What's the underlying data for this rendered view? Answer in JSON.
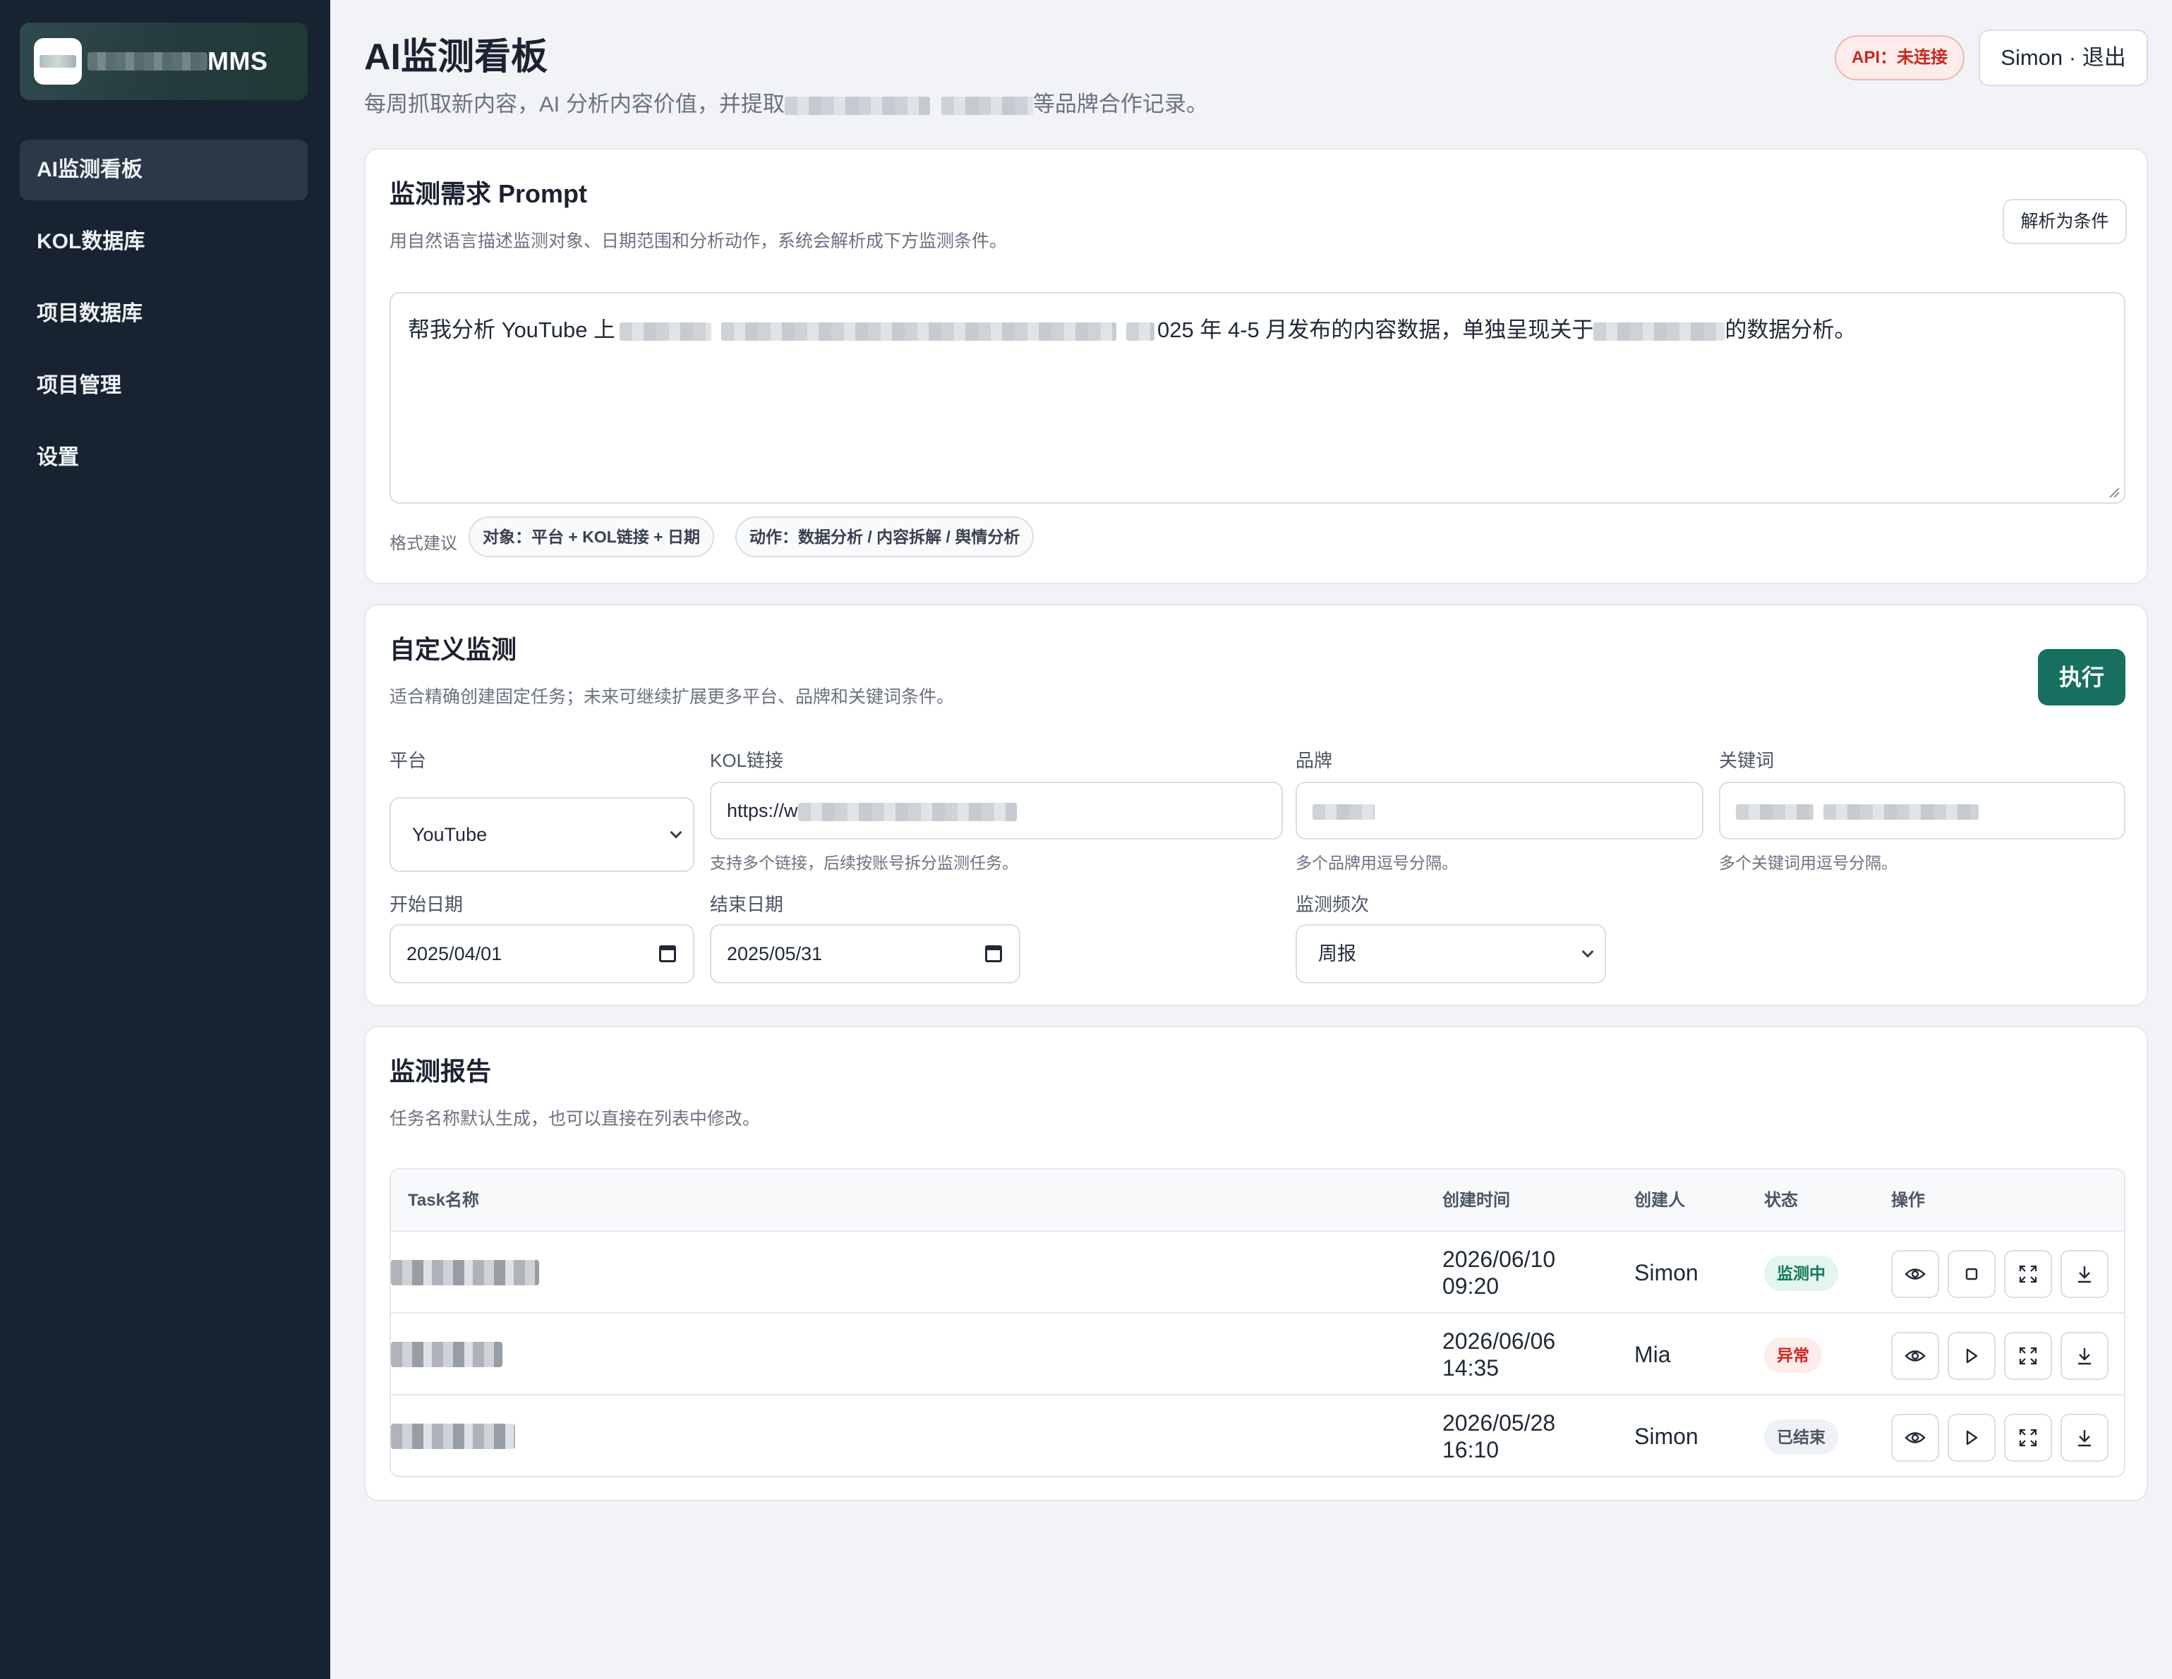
{
  "sidebar": {
    "brand": "MMS",
    "items": [
      {
        "label": "AI监测看板",
        "active": true
      },
      {
        "label": "KOL数据库"
      },
      {
        "label": "项目数据库"
      },
      {
        "label": "项目管理"
      },
      {
        "label": "设置"
      }
    ]
  },
  "header": {
    "title": "AI监测看板",
    "subtitle_prefix": "每周抓取新内容，AI 分析内容价值，并提取",
    "subtitle_suffix": "等品牌合作记录。",
    "api_badge": "API：未连接",
    "user_button": "Simon · 退出"
  },
  "prompt_card": {
    "title": "监测需求 Prompt",
    "description": "用自然语言描述监测对象、日期范围和分析动作，系统会解析成下方监测条件。",
    "parse_button": "解析为条件",
    "text_prefix": "帮我分析 YouTube 上",
    "text_middle": "025 年 4-5 月发布的内容数据，单独呈现关于",
    "text_suffix": "的数据分析。",
    "hint_label": "格式建议",
    "chips": [
      "对象：平台 + KOL链接 + 日期",
      "动作：数据分析 / 内容拆解 / 舆情分析"
    ]
  },
  "custom_card": {
    "title": "自定义监测",
    "description": "适合精确创建固定任务；未来可继续扩展更多平台、品牌和关键词条件。",
    "execute_button": "执行",
    "platform_label": "平台",
    "platform_value": "YouTube",
    "kol_label": "KOL链接",
    "kol_value": "https://w",
    "kol_help": "支持多个链接，后续按账号拆分监测任务。",
    "brand_label": "品牌",
    "brand_help": "多个品牌用逗号分隔。",
    "keyword_label": "关键词",
    "keyword_help": "多个关键词用逗号分隔。",
    "start_label": "开始日期",
    "start_value": "2025/04/01",
    "end_label": "结束日期",
    "end_value": "2025/05/31",
    "freq_label": "监测频次",
    "freq_value": "周报"
  },
  "reports_card": {
    "title": "监测报告",
    "description": "任务名称默认生成，也可以直接在列表中修改。",
    "columns": [
      "Task名称",
      "创建时间",
      "创建人",
      "状态",
      "操作"
    ],
    "rows": [
      {
        "date": "2026/06/10",
        "time": "09:20",
        "creator": "Simon",
        "status": "监测中",
        "second_action": "stop"
      },
      {
        "date": "2026/06/06",
        "time": "14:35",
        "creator": "Mia",
        "status": "异常",
        "second_action": "play"
      },
      {
        "date": "2026/05/28",
        "time": "16:10",
        "creator": "Simon",
        "status": "已结束",
        "second_action": "play"
      }
    ]
  },
  "colors": {
    "sidebar_bg": "#172331",
    "primary": "#17705f",
    "danger": "#c8281d",
    "status_running": "#127a5a",
    "status_error": "#c8281d",
    "status_done": "#4b5563"
  }
}
